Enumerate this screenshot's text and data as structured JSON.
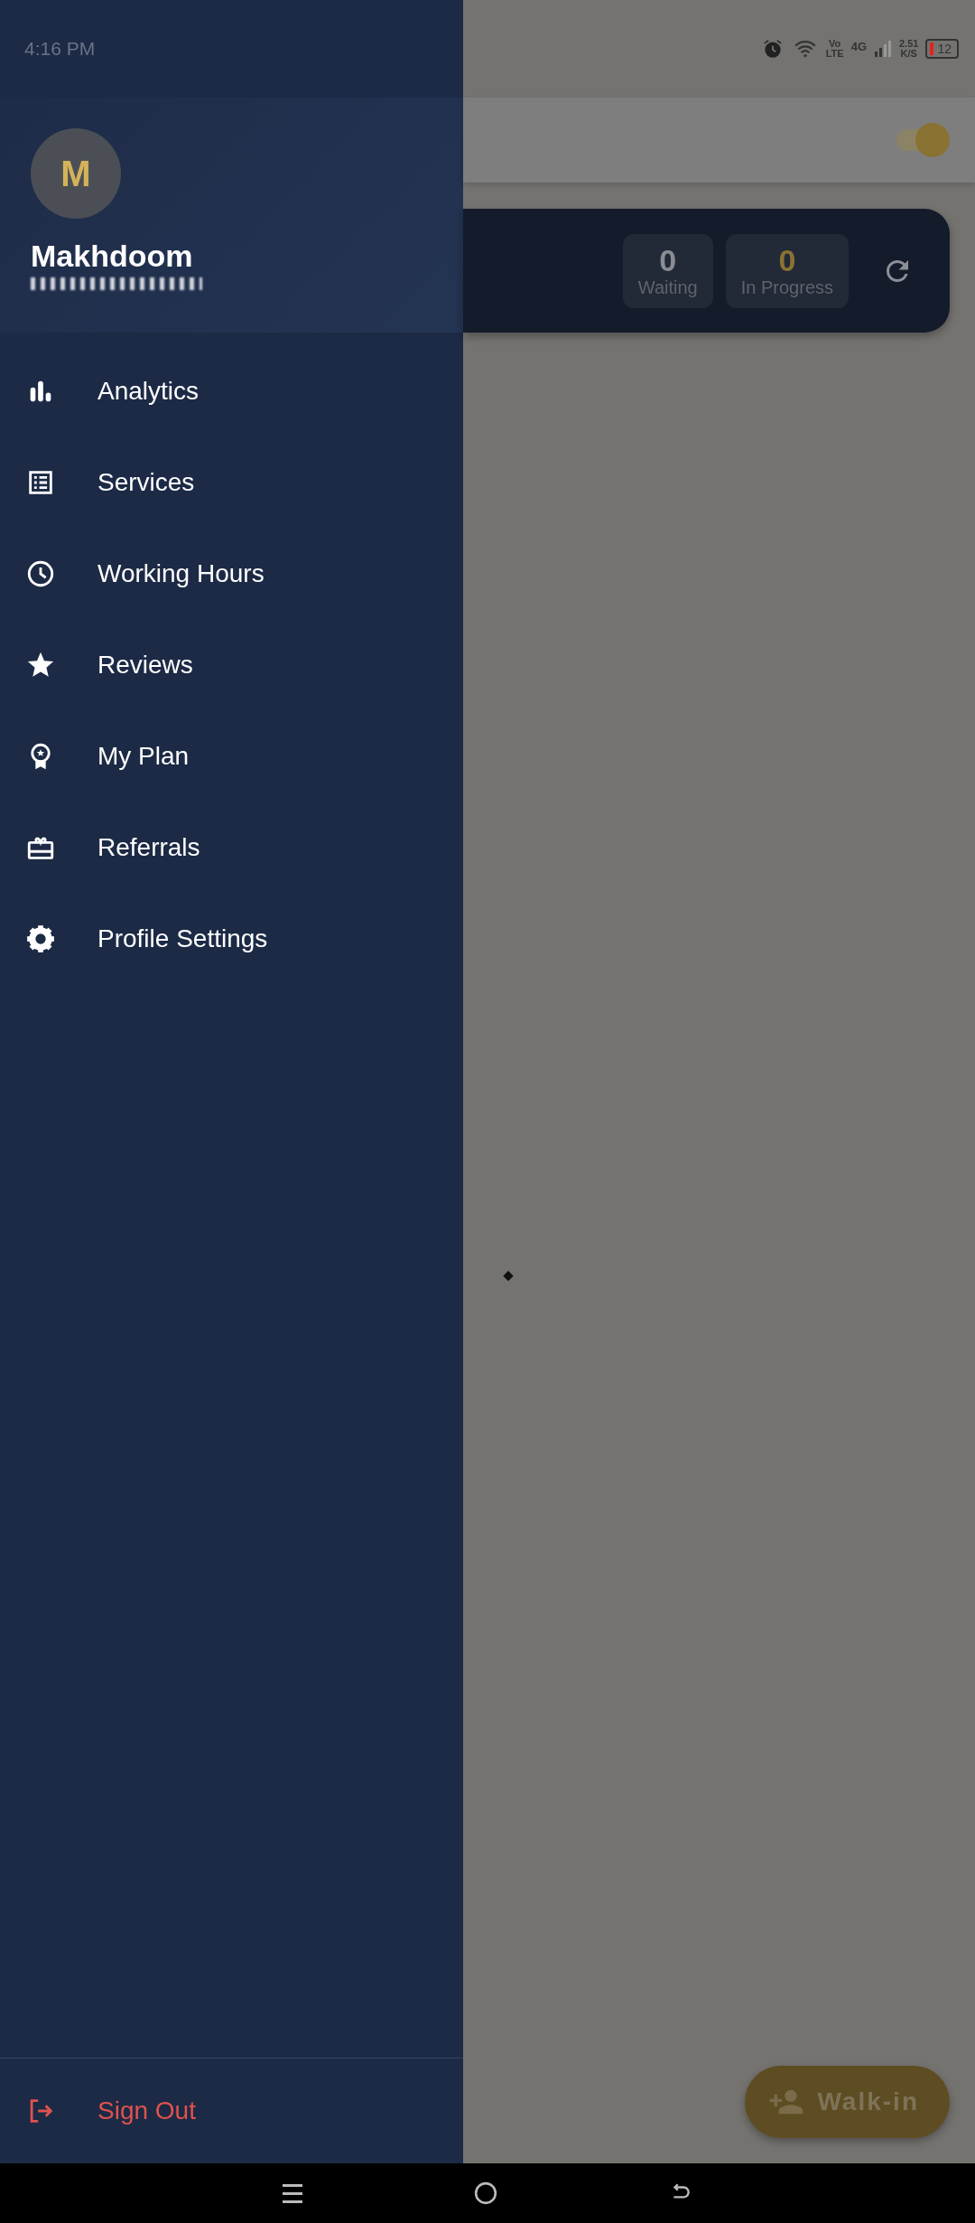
{
  "status_bar": {
    "time": "4:16 PM",
    "volte": [
      "Vo",
      "LTE"
    ],
    "network_type": "4G",
    "speed": [
      "2.51",
      "K/S"
    ],
    "battery": "12"
  },
  "drawer": {
    "avatar_initial": "M",
    "user_name": "Makhdoom",
    "items": [
      {
        "label": "Analytics",
        "kind": "chart"
      },
      {
        "label": "Services",
        "kind": "list"
      },
      {
        "label": "Working Hours",
        "kind": "clock"
      },
      {
        "label": "Reviews",
        "kind": "star"
      },
      {
        "label": "My Plan",
        "kind": "award"
      },
      {
        "label": "Referrals",
        "kind": "gift"
      },
      {
        "label": "Profile Settings",
        "kind": "gear"
      }
    ],
    "sign_out": "Sign Out"
  },
  "background": {
    "toggle": {
      "on": true
    },
    "stats": [
      {
        "value": "0",
        "label": "Waiting",
        "kind": "plain"
      },
      {
        "value": "0",
        "label": "In Progress",
        "kind": "accent"
      }
    ],
    "fab": "Walk-in"
  }
}
